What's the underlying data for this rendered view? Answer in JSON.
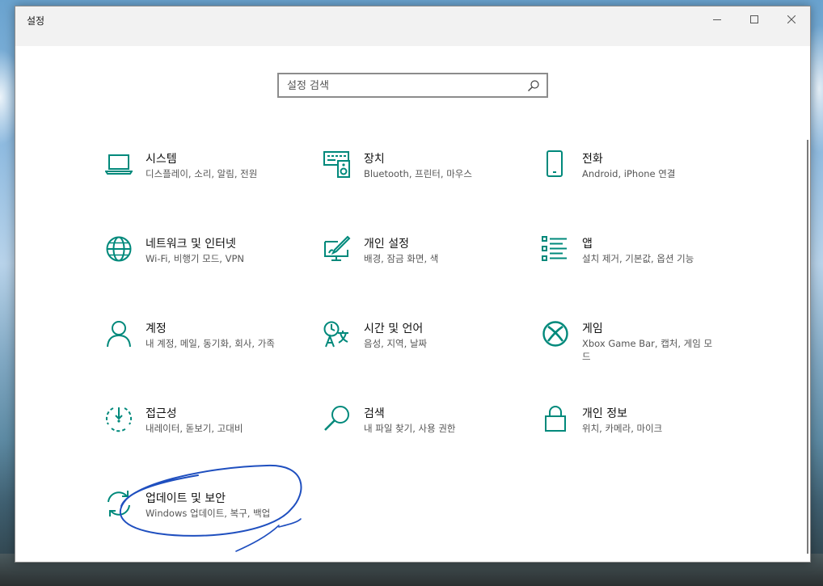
{
  "window": {
    "title": "설정",
    "controls": {
      "minimize": "minimize-icon",
      "maximize": "maximize-icon",
      "close": "close-icon"
    }
  },
  "search": {
    "placeholder": "설정 검색",
    "value": "",
    "icon": "search-icon"
  },
  "accent_color": "#00897b",
  "categories": [
    {
      "id": "system",
      "title": "시스템",
      "subtitle": "디스플레이, 소리, 알림, 전원",
      "icon": "laptop-icon"
    },
    {
      "id": "devices",
      "title": "장치",
      "subtitle": "Bluetooth, 프린터, 마우스",
      "icon": "keyboard-speaker-icon"
    },
    {
      "id": "phone",
      "title": "전화",
      "subtitle": "Android, iPhone 연결",
      "icon": "phone-icon"
    },
    {
      "id": "network",
      "title": "네트워크 및 인터넷",
      "subtitle": "Wi-Fi, 비행기 모드, VPN",
      "icon": "globe-icon"
    },
    {
      "id": "personalization",
      "title": "개인 설정",
      "subtitle": "배경, 잠금 화면, 색",
      "icon": "paint-monitor-icon"
    },
    {
      "id": "apps",
      "title": "앱",
      "subtitle": "설치 제거, 기본값, 옵션 기능",
      "icon": "app-list-icon"
    },
    {
      "id": "accounts",
      "title": "계정",
      "subtitle": "내 계정, 메일, 동기화, 회사, 가족",
      "icon": "person-icon"
    },
    {
      "id": "time",
      "title": "시간 및 언어",
      "subtitle": "음성, 지역, 날짜",
      "icon": "time-language-icon"
    },
    {
      "id": "gaming",
      "title": "게임",
      "subtitle": "Xbox Game Bar, 캡처, 게임 모드",
      "icon": "xbox-icon"
    },
    {
      "id": "ease",
      "title": "접근성",
      "subtitle": "내레이터, 돋보기, 고대비",
      "icon": "ease-of-access-icon"
    },
    {
      "id": "search",
      "title": "검색",
      "subtitle": "내 파일 찾기, 사용 권한",
      "icon": "magnifier-icon"
    },
    {
      "id": "privacy",
      "title": "개인 정보",
      "subtitle": "위치, 카메라, 마이크",
      "icon": "lock-icon"
    },
    {
      "id": "update",
      "title": "업데이트 및 보안",
      "subtitle": "Windows 업데이트, 복구, 백업",
      "icon": "sync-icon"
    }
  ]
}
